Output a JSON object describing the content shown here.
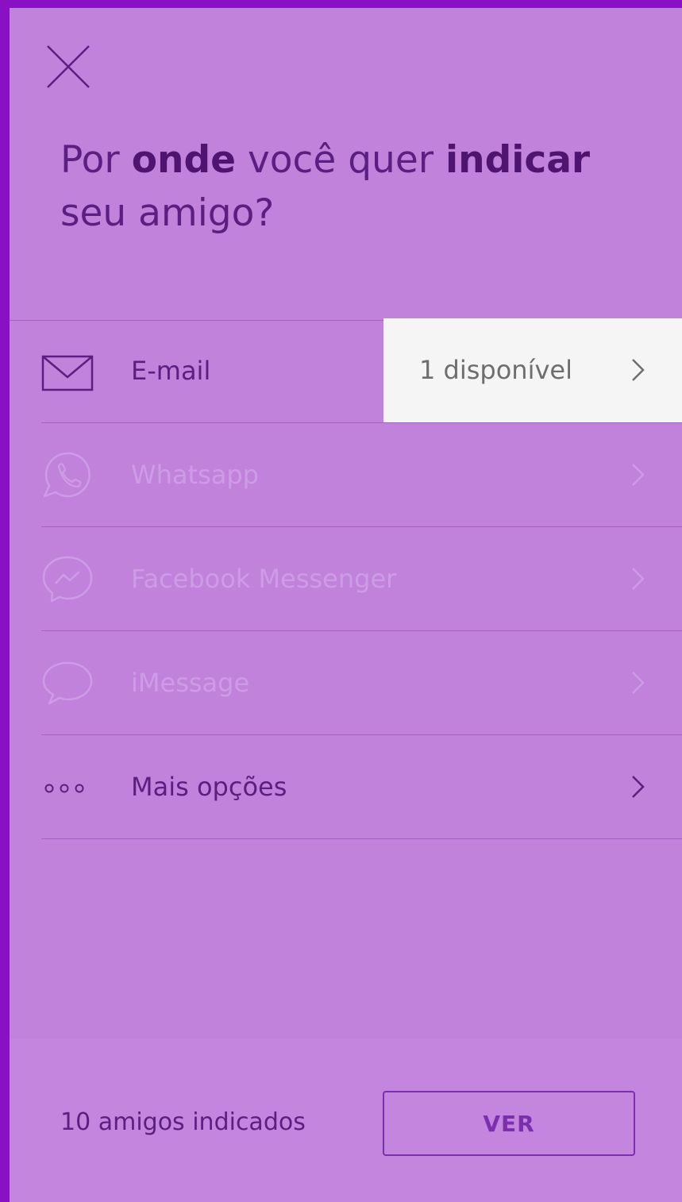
{
  "header": {
    "title_prefix": "Por",
    "title_bold_1": "onde",
    "title_mid": "você quer",
    "title_bold_2": "indicar",
    "title_suffix": "seu amigo?"
  },
  "options": [
    {
      "label": "E-mail",
      "icon": "mail-icon",
      "enabled": true
    },
    {
      "label": "Whatsapp",
      "icon": "whatsapp-icon",
      "enabled": false
    },
    {
      "label": "Facebook Messenger",
      "icon": "messenger-icon",
      "enabled": false
    },
    {
      "label": "iMessage",
      "icon": "imessage-icon",
      "enabled": false
    },
    {
      "label": "Mais opções",
      "icon": "more-dots-icon",
      "enabled": true
    }
  ],
  "email_availability": "1 disponível",
  "footer": {
    "count_text": "10 amigos indicados",
    "ver_label": "VER"
  },
  "colors": {
    "background": "#8a10c4",
    "panel": "#c182dc",
    "text_primary": "#5a1f80",
    "text_disabled": "#ce9ce6",
    "button_accent": "#7b2fae",
    "availability_bg": "#f5f5f5"
  }
}
